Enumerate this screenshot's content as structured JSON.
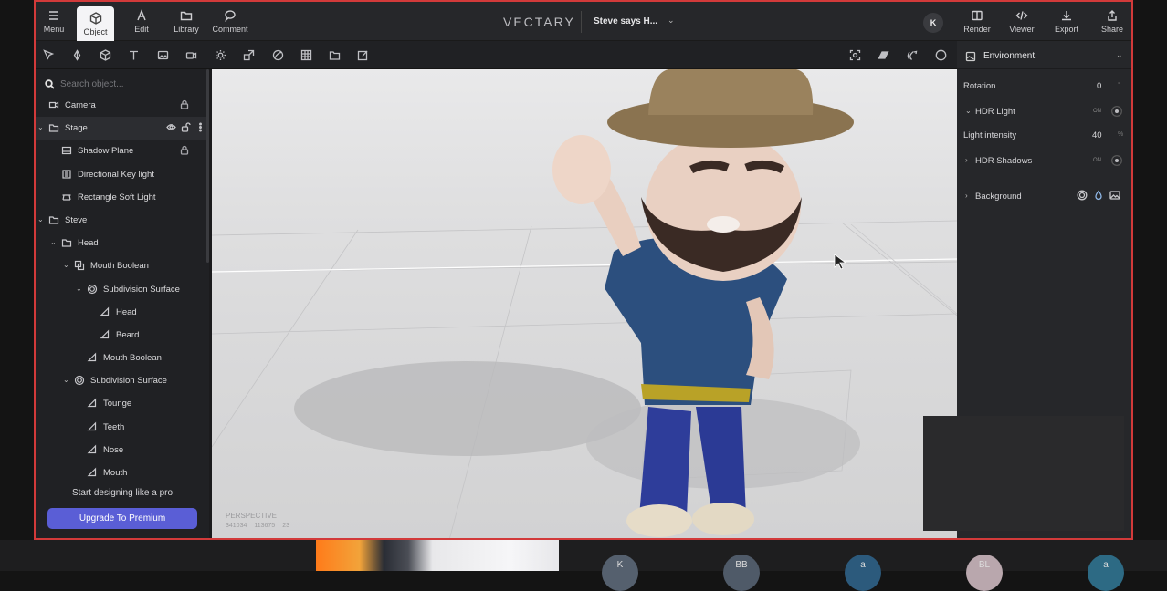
{
  "topbar": {
    "menu_label": "Menu",
    "tabs": [
      {
        "label": "Object",
        "icon": "cube-icon",
        "active": true
      },
      {
        "label": "Edit",
        "icon": "pen-icon"
      },
      {
        "label": "Library",
        "icon": "folder-icon"
      },
      {
        "label": "Comment",
        "icon": "comment-icon"
      }
    ],
    "logo": "VECTARY",
    "document_name": "Steve says H...",
    "avatar_initial": "K",
    "actions": [
      {
        "label": "Render",
        "icon": "render-icon"
      },
      {
        "label": "Viewer",
        "icon": "code-icon"
      },
      {
        "label": "Export",
        "icon": "download-icon"
      },
      {
        "label": "Share",
        "icon": "share-icon"
      }
    ]
  },
  "left_panel": {
    "search_placeholder": "Search object...",
    "tree": [
      {
        "label": "Camera",
        "icon": "camera-icon",
        "level": 0,
        "locked": true
      },
      {
        "label": "Stage",
        "icon": "folder-icon",
        "level": 0,
        "expanded": true,
        "selected": true
      },
      {
        "label": "Shadow Plane",
        "icon": "plane-icon",
        "level": 1,
        "locked": true
      },
      {
        "label": "Directional Key light",
        "icon": "light-icon",
        "level": 1
      },
      {
        "label": "Rectangle Soft Light",
        "icon": "rect-light-icon",
        "level": 1
      },
      {
        "label": "Steve",
        "icon": "folder-icon",
        "level": 0,
        "expanded": true
      },
      {
        "label": "Head",
        "icon": "folder-icon",
        "level": 1,
        "expanded": true
      },
      {
        "label": "Mouth Boolean",
        "icon": "boolean-icon",
        "level": 2,
        "expanded": true
      },
      {
        "label": "Subdivision Surface",
        "icon": "subdivision-icon",
        "level": 3,
        "expanded": true
      },
      {
        "label": "Head",
        "icon": "mesh-icon",
        "level": 4
      },
      {
        "label": "Beard",
        "icon": "mesh-icon",
        "level": 4
      },
      {
        "label": "Mouth Boolean",
        "icon": "mesh-icon",
        "level": 3
      },
      {
        "label": "Subdivision Surface",
        "icon": "subdivision-icon",
        "level": 2,
        "expanded": true
      },
      {
        "label": "Tounge",
        "icon": "mesh-icon",
        "level": 3
      },
      {
        "label": "Teeth",
        "icon": "mesh-icon",
        "level": 3
      },
      {
        "label": "Nose",
        "icon": "mesh-icon",
        "level": 3
      },
      {
        "label": "Mouth",
        "icon": "mesh-icon",
        "level": 3
      }
    ],
    "promo_text": "Start designing like a pro",
    "upgrade_label": "Upgrade To Premium"
  },
  "viewport": {
    "camera_mode": "PERSPECTIVE",
    "stats": [
      "341034",
      "113675",
      "23"
    ]
  },
  "right_panel": {
    "section_title": "Environment",
    "rotation_label": "Rotation",
    "rotation_value": "0",
    "rotation_unit": "°",
    "hdr_light_label": "HDR Light",
    "hdr_light_state": "ON",
    "light_intensity_label": "Light intensity",
    "light_intensity_value": "40",
    "light_intensity_unit": "%",
    "hdr_shadows_label": "HDR Shadows",
    "hdr_shadows_state": "ON",
    "background_label": "Background"
  },
  "taskbar": {
    "participants": [
      "K",
      "BB",
      "a",
      "BL",
      "a"
    ]
  }
}
